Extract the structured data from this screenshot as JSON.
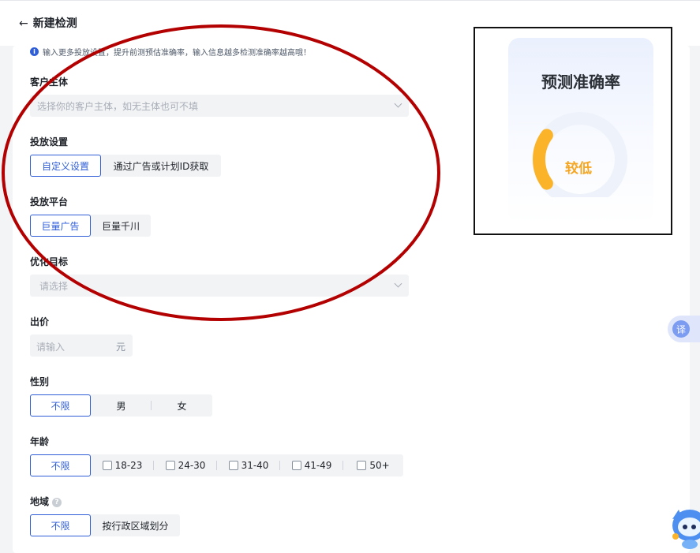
{
  "header": {
    "back_icon": "arrow-left-icon",
    "title": "新建检测"
  },
  "tip": {
    "icon": "info-icon",
    "text": "输入更多投放设置，提升前测预估准确率，输入信息越多检测准确率越高哦！"
  },
  "client": {
    "label": "客户主体",
    "placeholder": "选择你的客户主体，如无主体也可不填"
  },
  "delivery_setting": {
    "label": "投放设置",
    "options": [
      "自定义设置",
      "通过广告或计划ID获取"
    ],
    "selected": "自定义设置"
  },
  "platform": {
    "label": "投放平台",
    "options": [
      "巨量广告",
      "巨量千川"
    ],
    "selected": "巨量广告"
  },
  "optimization_goal": {
    "label": "优化目标",
    "placeholder": "请选择"
  },
  "bid": {
    "label": "出价",
    "placeholder": "请输入",
    "unit": "元"
  },
  "gender": {
    "label": "性别",
    "options": [
      "不限",
      "男",
      "女"
    ],
    "selected": "不限"
  },
  "age": {
    "label": "年龄",
    "options": [
      "不限",
      "18-23",
      "24-30",
      "31-40",
      "41-49",
      "50+"
    ],
    "selected": "不限"
  },
  "region": {
    "label": "地域",
    "help_icon": "question-icon",
    "options": [
      "不限",
      "按行政区域划分"
    ],
    "selected": "不限"
  },
  "prediction": {
    "title": "预测准确率",
    "level": "较低",
    "gauge_fraction": 0.2
  },
  "side": {
    "translate_label": "译",
    "assistant_icon": "assistant-mascot-icon"
  },
  "colors": {
    "accent": "#2f5ed8",
    "warning": "#f5a623",
    "annotation": "#b30000"
  }
}
